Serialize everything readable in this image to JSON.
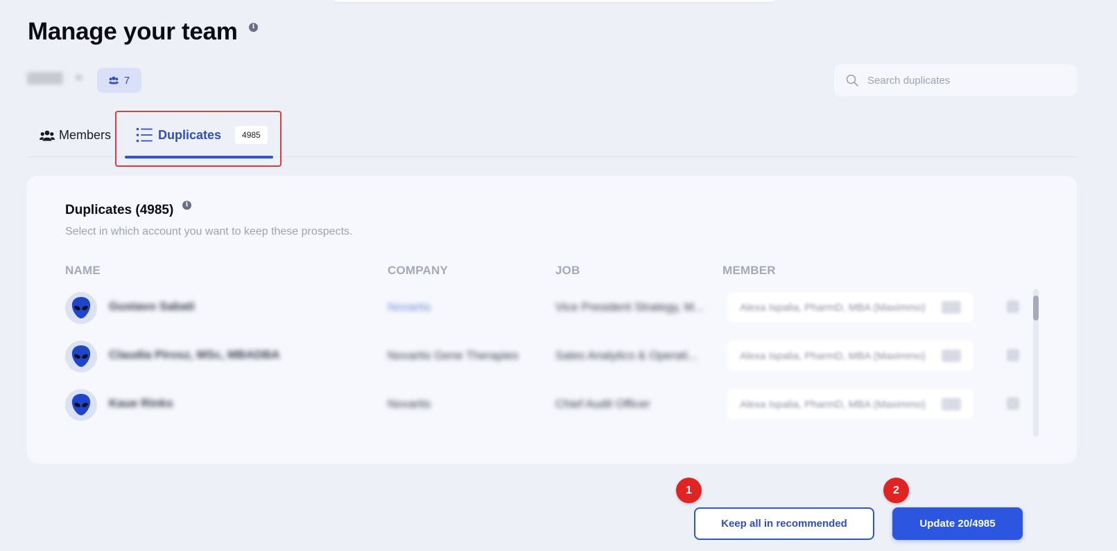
{
  "page": {
    "title": "Manage your team",
    "info_icon": "info-icon"
  },
  "team": {
    "members_count": "7",
    "members_icon": "users-icon"
  },
  "search": {
    "placeholder": "Search duplicates",
    "value": "",
    "icon": "search-icon"
  },
  "tabs": [
    {
      "label": "Members",
      "icon": "users-icon",
      "active": false
    },
    {
      "label": "Duplicates",
      "icon": "list-icon",
      "active": true,
      "count": "4985"
    }
  ],
  "duplicates": {
    "title": "Duplicates (4985)",
    "subtitle": "Select in which account you want to keep these prospects.",
    "columns": [
      "NAME",
      "COMPANY",
      "JOB",
      "MEMBER"
    ],
    "rows": [
      {
        "name": "Gustavo Sabati",
        "company": "Novartis",
        "job": "Vice President Strategy, M...",
        "member": "Alexa Ispalia, PharmD, MBA (Maximmo)"
      },
      {
        "name": "Claudia Pirosz, MSc, MBADBA",
        "company": "Novartis Gene Therapies",
        "job": "Sales Analytics & Operati...",
        "member": "Alexa Ispalia, PharmD, MBA (Maximmo)"
      },
      {
        "name": "Kaue Rinks",
        "company": "Novartis",
        "job": "Chief Audit Officer",
        "member": "Alexa Ispalia, PharmD, MBA (Maximmo)"
      }
    ]
  },
  "actions": {
    "keep_label": "Keep all in recommended",
    "update_label": "Update 20/4985",
    "step1": "1",
    "step2": "2"
  },
  "colors": {
    "accent": "#2d56e0",
    "highlight": "#e23b3b",
    "background": "#eef0f8"
  }
}
